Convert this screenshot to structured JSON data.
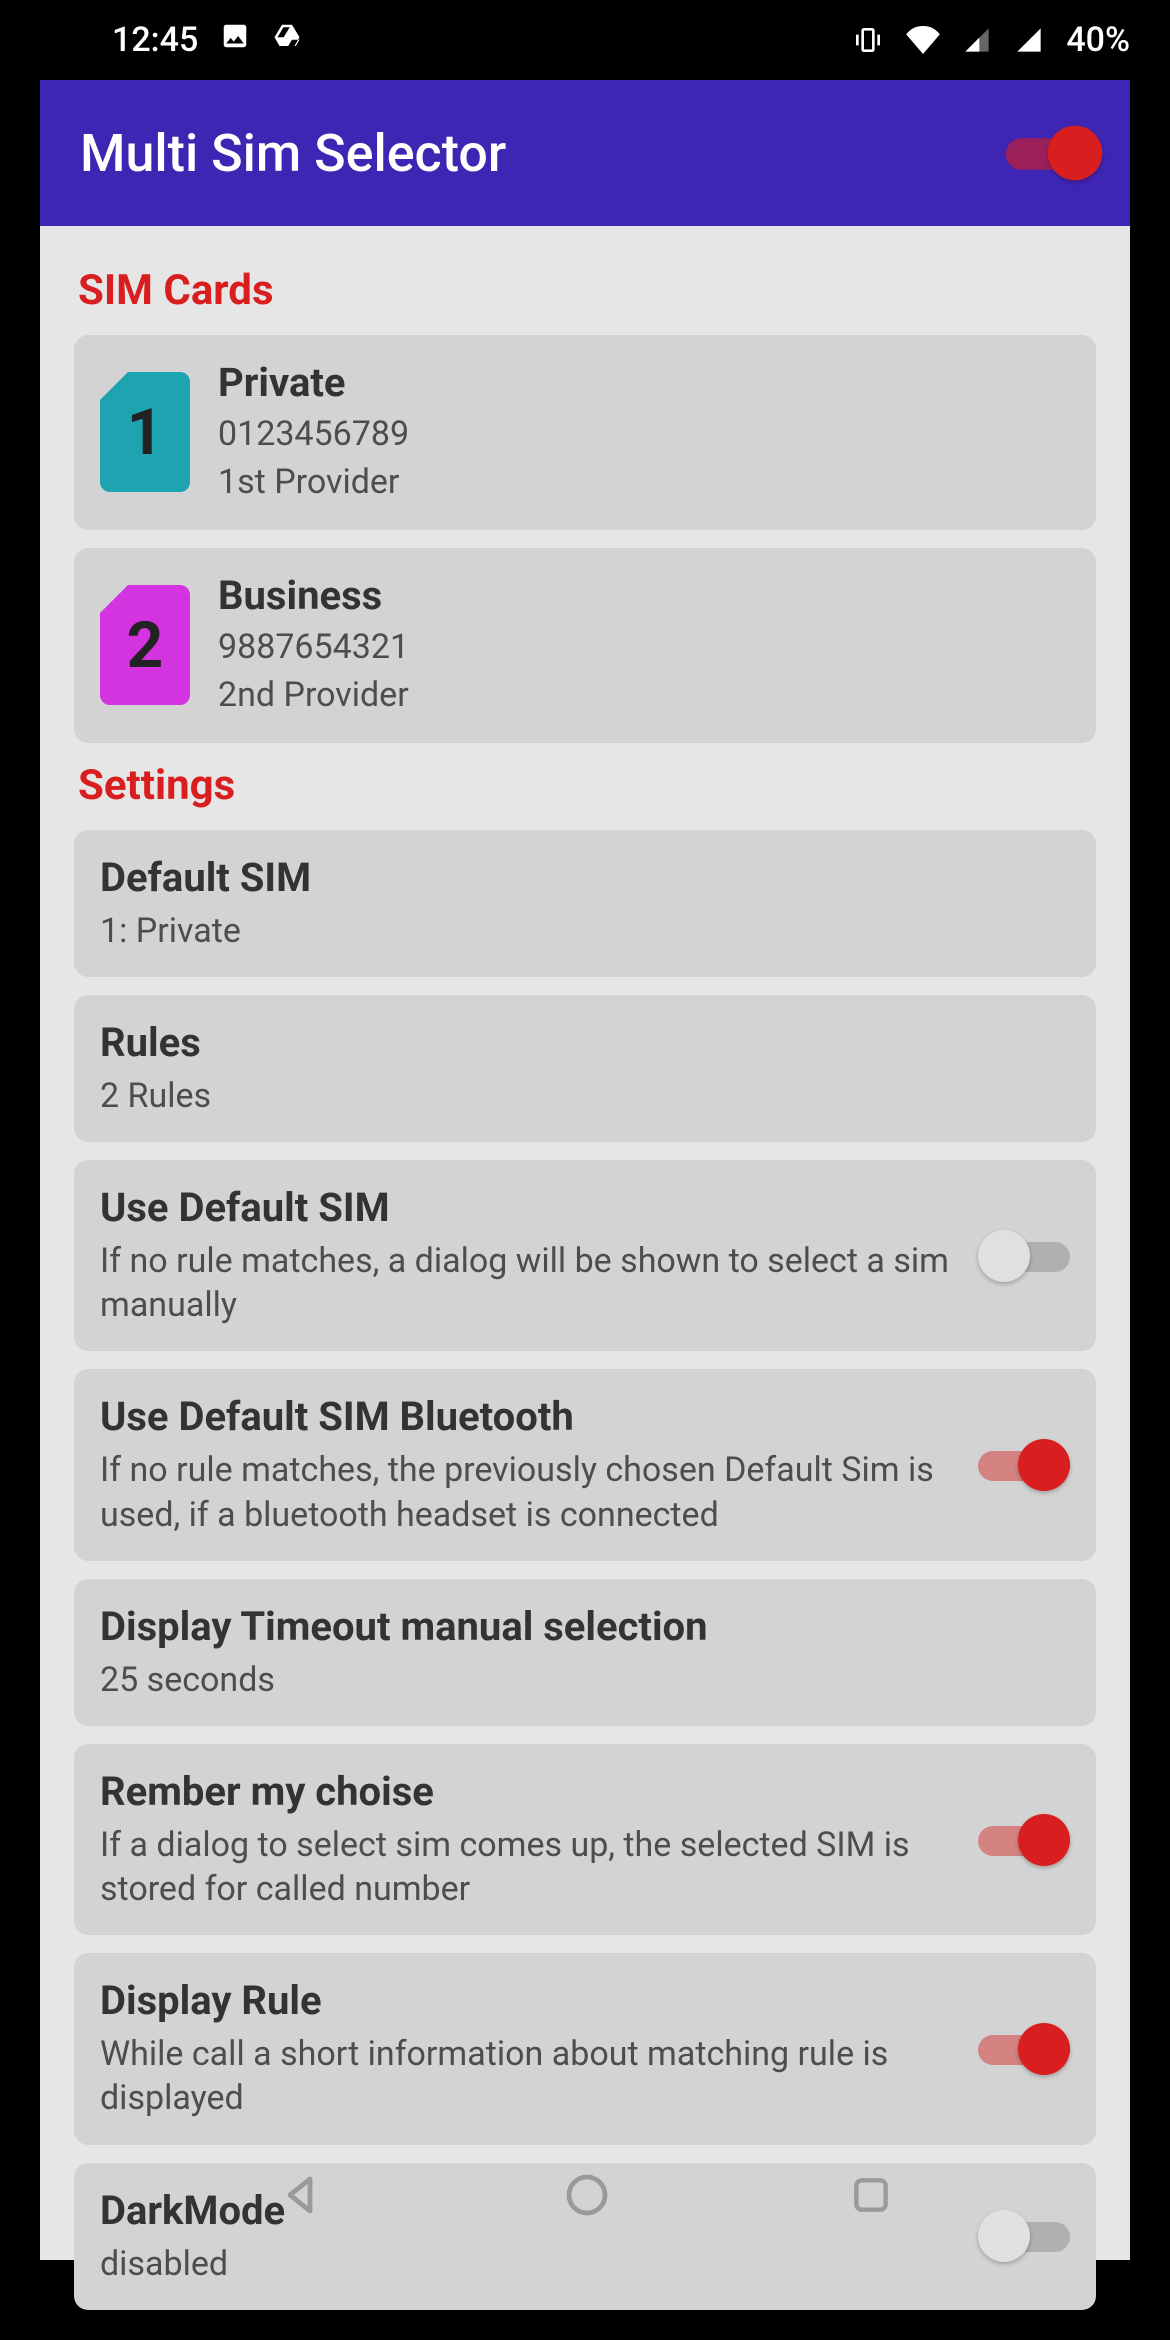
{
  "status": {
    "time": "12:45",
    "battery": "40%"
  },
  "appbar": {
    "title": "Multi Sim Selector",
    "master_switch_on": true
  },
  "sections": {
    "sim": "SIM Cards",
    "settings": "Settings"
  },
  "sims": [
    {
      "slot": "1",
      "label": "Private",
      "number": "0123456789",
      "provider": "1st Provider"
    },
    {
      "slot": "2",
      "label": "Business",
      "number": "9887654321",
      "provider": "2nd Provider"
    }
  ],
  "settings": {
    "default_sim": {
      "title": "Default SIM",
      "value": "1: Private"
    },
    "rules": {
      "title": "Rules",
      "value": "2 Rules"
    },
    "use_default": {
      "title": "Use Default SIM",
      "desc": "If no rule matches, a dialog will be shown to select a sim manually",
      "on": false
    },
    "use_default_bt": {
      "title": "Use Default SIM Bluetooth",
      "desc": "If no rule matches, the previously chosen Default Sim is used, if a bluetooth headset is connected",
      "on": true
    },
    "timeout": {
      "title": "Display Timeout manual selection",
      "value": "25 seconds"
    },
    "remember": {
      "title": "Rember my choise",
      "desc": "If a dialog to select sim comes up, the selected SIM is stored for called number",
      "on": true
    },
    "display_rule": {
      "title": "Display Rule",
      "desc": "While call a short information about matching rule is displayed",
      "on": true
    },
    "darkmode": {
      "title": "DarkMode",
      "value": "disabled",
      "on": false
    }
  }
}
